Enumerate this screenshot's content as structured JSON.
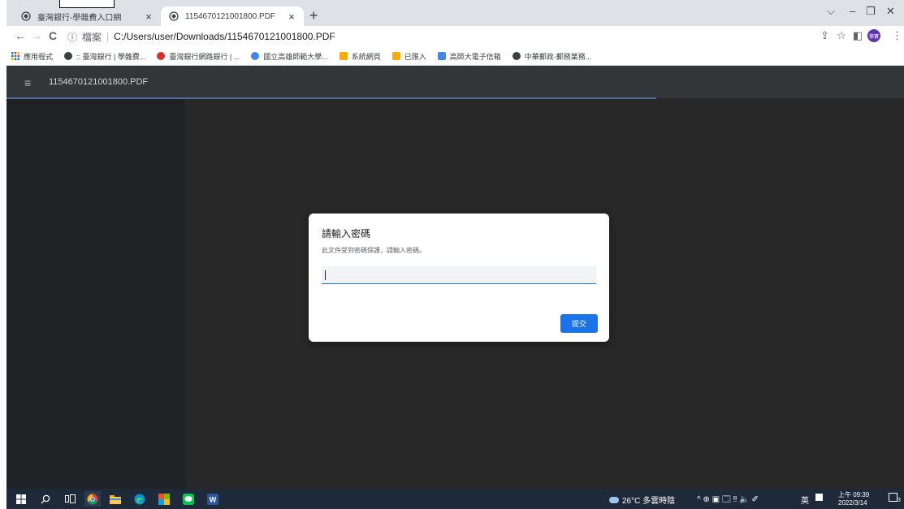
{
  "browser": {
    "tabs": [
      {
        "title": "臺灣銀行-學雜費入口網",
        "active": false
      },
      {
        "title": "1154670121001800.PDF",
        "active": true
      }
    ],
    "new_tab": "+",
    "close_glyph": "×",
    "window_controls": {
      "dropdown": "⌵",
      "minimize": "–",
      "restore": "❐",
      "close": "✕"
    },
    "address": {
      "info_icon": "ⓘ",
      "scheme_label": "檔案",
      "separator": "|",
      "url": "C:/Users/user/Downloads/1154670121001800.PDF"
    },
    "nav": {
      "back": "←",
      "forward": "→",
      "reload": "C"
    },
    "right_tools": {
      "share": "⇪",
      "star": "☆",
      "sidebar": "◧",
      "menu": "⋮"
    },
    "profile_initials": "學寶"
  },
  "bookmarks": [
    {
      "label": "應用程式",
      "icon_color": "#1a73e8",
      "icon": "apps-grid-icon"
    },
    {
      "label": ":: 臺灣銀行 | 學雜費...",
      "icon_color": "#3c4043",
      "icon": "globe-icon"
    },
    {
      "label": "臺灣銀行網路銀行 | ...",
      "icon_color": "#d93025",
      "icon": "bank-icon"
    },
    {
      "label": "國立高雄師範大學...",
      "icon_color": "#4285f4",
      "icon": "school-icon"
    },
    {
      "label": "系統網頁",
      "icon_color": "#f9ab00",
      "icon": "folder-icon"
    },
    {
      "label": "已匯入",
      "icon_color": "#f9ab00",
      "icon": "folder-icon"
    },
    {
      "label": "高師大電子信箱",
      "icon_color": "#4285f4",
      "icon": "mail-icon"
    },
    {
      "label": "中華郵政-郵務業務...",
      "icon_color": "#3c4043",
      "icon": "globe-icon"
    }
  ],
  "viewer": {
    "menu_icon": "≡",
    "file_name": "1154670121001800.PDF"
  },
  "dialog": {
    "title": "請輸入密碼",
    "message": "此文件受到密碼保護，請輸入密碼。",
    "input_value": "",
    "submit_label": "提交",
    "accent": "#1a73e8"
  },
  "taskbar": {
    "weather": "26°C 多雲時陰",
    "tray": "^ ⊕ ▣ 🗔 ‼ 🔈 ✐",
    "ime": "英",
    "clock_time": "上午 09:39",
    "clock_date": "2022/3/14",
    "notification_count": "3"
  }
}
